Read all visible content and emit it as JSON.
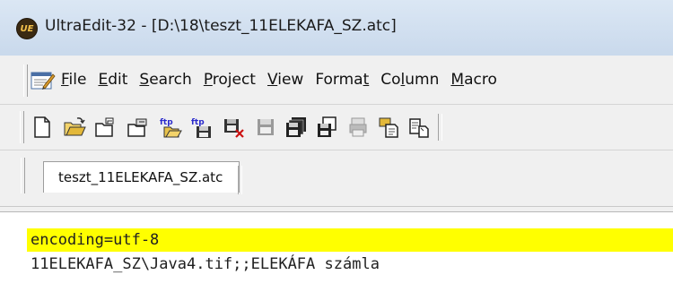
{
  "window": {
    "title": "UltraEdit-32 - [D:\\18\\teszt_11ELEKAFA_SZ.atc]",
    "app_icon_text": "UE"
  },
  "menu": {
    "items": [
      {
        "label_pre": "",
        "label_u": "F",
        "label_post": "ile"
      },
      {
        "label_pre": "",
        "label_u": "E",
        "label_post": "dit"
      },
      {
        "label_pre": "",
        "label_u": "S",
        "label_post": "earch"
      },
      {
        "label_pre": "",
        "label_u": "P",
        "label_post": "roject"
      },
      {
        "label_pre": "",
        "label_u": "V",
        "label_post": "iew"
      },
      {
        "label_pre": "Forma",
        "label_u": "t",
        "label_post": ""
      },
      {
        "label_pre": "Co",
        "label_u": "l",
        "label_post": "umn"
      },
      {
        "label_pre": "",
        "label_u": "M",
        "label_post": "acro"
      }
    ]
  },
  "toolbar": {
    "buttons": [
      "new-file-icon",
      "open-file-icon",
      "open-folder-icon",
      "recent-files-icon",
      "ftp-open-icon",
      "ftp-save-icon",
      "close-file-icon",
      "save-icon",
      "save-all-icon",
      "save-as-icon",
      "print-icon",
      "copy-icon",
      "paste-icon"
    ]
  },
  "tabs": [
    {
      "label": "teszt_11ELEKAFA_SZ.atc"
    }
  ],
  "editor": {
    "lines": [
      "encoding=utf-8",
      "11ELEKAFA_SZ\\Java4.tif;;ELEKÁFA számla"
    ],
    "highlight_color": "#ffff00"
  }
}
